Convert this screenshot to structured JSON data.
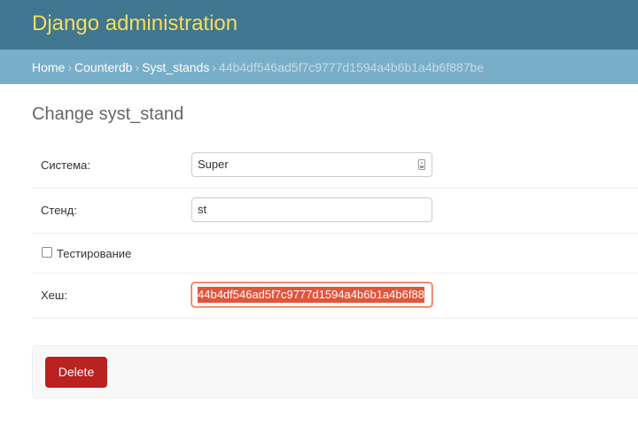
{
  "header": {
    "site_title": "Django administration"
  },
  "breadcrumbs": {
    "home": "Home",
    "app": "Counterdb",
    "model": "Syst_stands",
    "current": "44b4df546ad5f7c9777d1594a4b6b1a4b6f887be",
    "separator": "›"
  },
  "page": {
    "title": "Change syst_stand"
  },
  "form": {
    "sistema": {
      "label": "Система:",
      "value": "Super"
    },
    "stend": {
      "label": "Стенд:",
      "value": "st"
    },
    "testing": {
      "label": "Тестирование",
      "checked": false
    },
    "hash": {
      "label": "Хеш:",
      "value": "44b4df546ad5f7c9777d1594a4b6b1a4b6f88"
    }
  },
  "actions": {
    "delete_label": "Delete"
  },
  "colors": {
    "header_bg": "#417690",
    "site_title": "#f5dd5d",
    "breadcrumbs_bg": "#79aec8",
    "delete_bg": "#ba2121",
    "selection": "#e2553a"
  }
}
